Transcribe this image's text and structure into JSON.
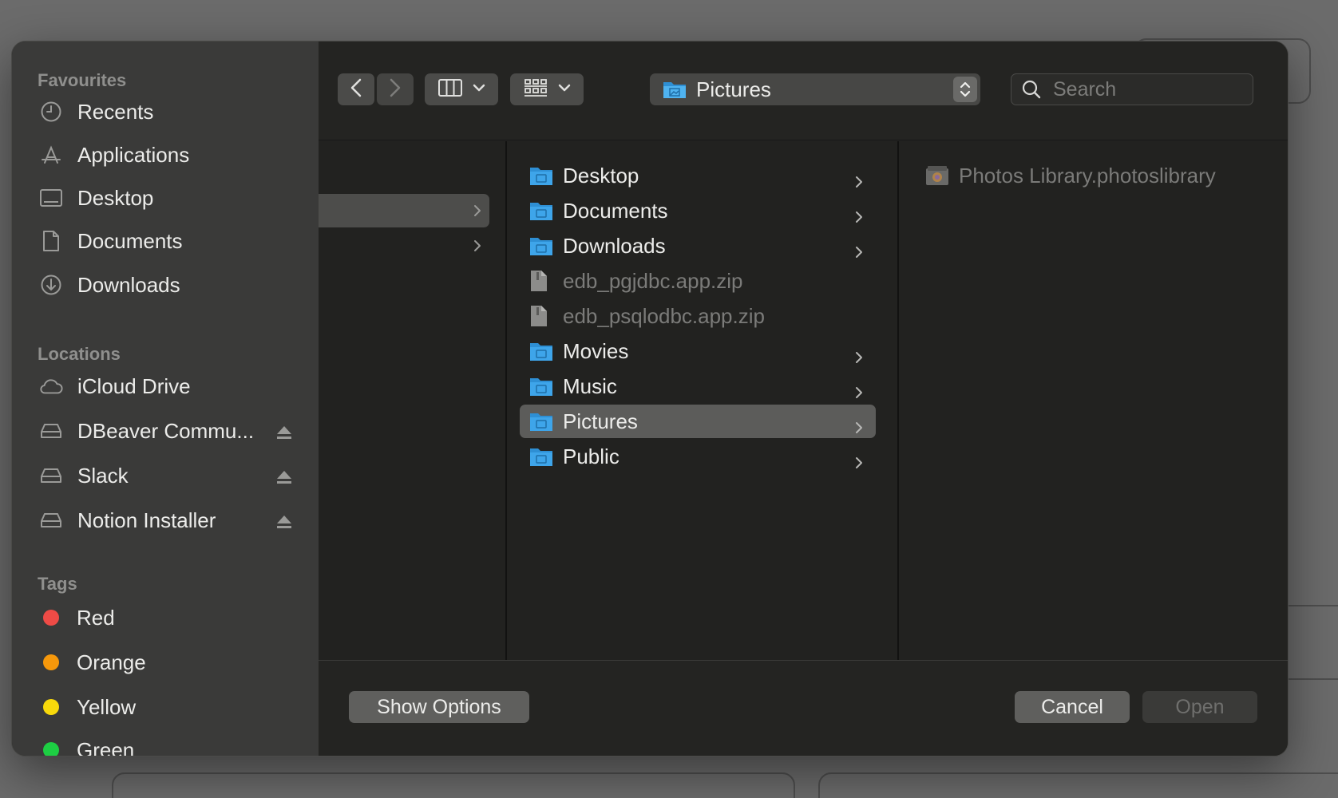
{
  "sidebar": {
    "favourites_title": "Favourites",
    "favourites": [
      {
        "label": "Recents",
        "icon": "clock-icon"
      },
      {
        "label": "Applications",
        "icon": "applications-icon"
      },
      {
        "label": "Desktop",
        "icon": "desktop-icon"
      },
      {
        "label": "Documents",
        "icon": "document-icon"
      },
      {
        "label": "Downloads",
        "icon": "download-icon"
      }
    ],
    "locations_title": "Locations",
    "locations": [
      {
        "label": "iCloud Drive",
        "icon": "cloud-icon"
      },
      {
        "label": "DBeaver Commu...",
        "icon": "drive-icon",
        "eject": true
      },
      {
        "label": "Slack",
        "icon": "drive-icon",
        "eject": true
      },
      {
        "label": "Notion Installer",
        "icon": "drive-icon",
        "eject": true
      }
    ],
    "tags_title": "Tags",
    "tags": [
      {
        "label": "Red",
        "color": "#ee4b46"
      },
      {
        "label": "Orange",
        "color": "#f6980b"
      },
      {
        "label": "Yellow",
        "color": "#f8d90b"
      },
      {
        "label": "Green",
        "color": "#1dce43"
      }
    ]
  },
  "toolbar": {
    "current_folder": "Pictures",
    "search_placeholder": "Search"
  },
  "columns": {
    "home_folder": [
      {
        "label": "Desktop",
        "type": "folder",
        "enabled": true
      },
      {
        "label": "Documents",
        "type": "folder",
        "enabled": true
      },
      {
        "label": "Downloads",
        "type": "folder",
        "enabled": true
      },
      {
        "label": "edb_pgjdbc.app.zip",
        "type": "file",
        "enabled": false
      },
      {
        "label": "edb_psqlodbc.app.zip",
        "type": "file",
        "enabled": false
      },
      {
        "label": "Movies",
        "type": "folder",
        "enabled": true
      },
      {
        "label": "Music",
        "type": "folder",
        "enabled": true
      },
      {
        "label": "Pictures",
        "type": "folder",
        "enabled": true,
        "selected": true
      },
      {
        "label": "Public",
        "type": "folder",
        "enabled": true
      }
    ],
    "pictures_folder": [
      {
        "label": "Photos Library.photoslibrary",
        "type": "package",
        "enabled": false
      }
    ]
  },
  "bottom": {
    "show_options": "Show Options",
    "cancel": "Cancel",
    "open": "Open"
  },
  "colors": {
    "folder_blue": "#3ea5ea",
    "selection": "#5c5c5a",
    "dialog_bg": "#232321",
    "sidebar_bg": "#3a3a39"
  }
}
